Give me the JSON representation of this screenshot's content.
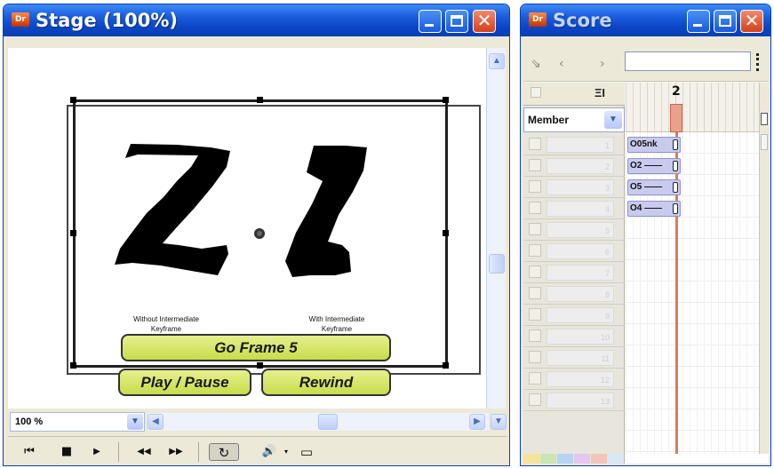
{
  "stage": {
    "title": "Stage (100%)",
    "app_badge": "Dr",
    "shape_labels": [
      [
        "Without Intermediate",
        "Keyframe"
      ],
      [
        "With Intermediate",
        "Keyframe"
      ]
    ],
    "buttons": {
      "go_frame": "Go Frame 5",
      "play_pause": "Play / Pause",
      "rewind": "Rewind"
    },
    "zoom_value": "100 %",
    "control_glyphs": {
      "rewind": "⏮",
      "stop": "■",
      "play": "▶",
      "step_back": "◀◀",
      "step_forward": "▶▶",
      "loop": "↻",
      "volume": "🔊",
      "selected_only": "▭"
    }
  },
  "score": {
    "title": "Score",
    "app_badge": "Dr",
    "nav_glyphs": [
      "⇘",
      "‹",
      "›"
    ],
    "header_glyph": "ΞI",
    "current_frame": "2",
    "member_dropdown": "Member",
    "channels": [
      "1",
      "2",
      "3",
      "4",
      "5",
      "6",
      "7",
      "8",
      "9",
      "10",
      "11",
      "12",
      "13"
    ],
    "sprites": [
      {
        "channel": 1,
        "label": "O05nk"
      },
      {
        "channel": 2,
        "label": "O2 ——"
      },
      {
        "channel": 3,
        "label": "O5 ——"
      },
      {
        "channel": 4,
        "label": "O4 ——"
      }
    ],
    "color_swatches": [
      "#f6e39a",
      "#c9e6b0",
      "#b4d4f2",
      "#e6c6ec",
      "#f3c4b8",
      "#d9e7f6"
    ]
  }
}
